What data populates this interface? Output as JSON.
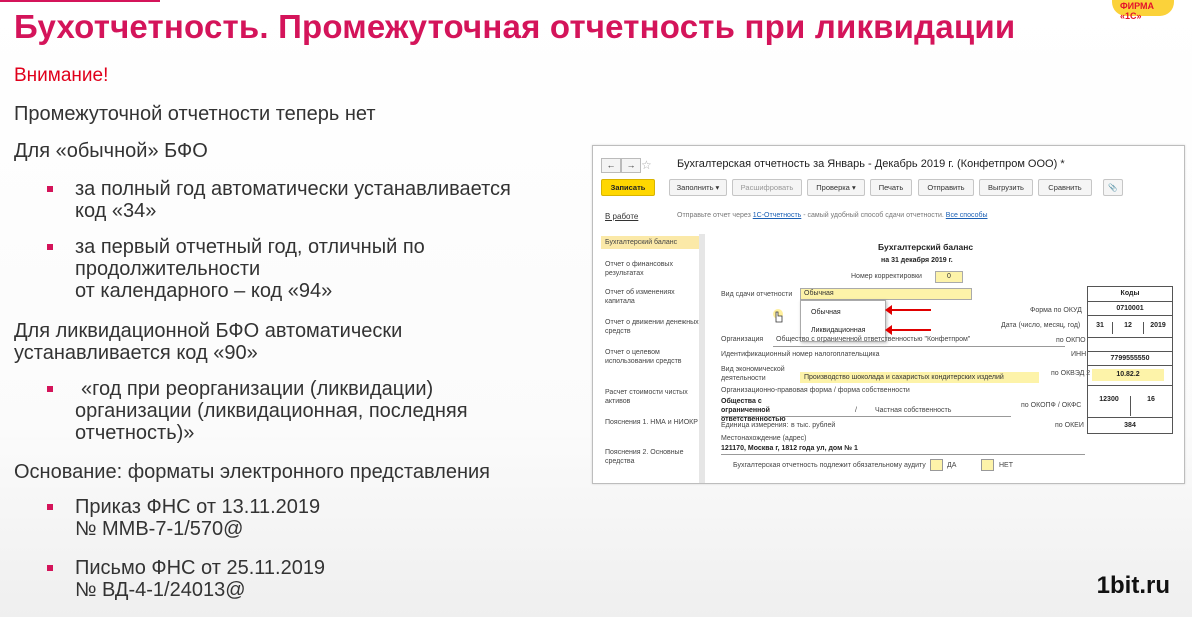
{
  "title": "Бухотчетность. Промежуточная отчетность при ликвидации",
  "logo_text": "ФИРМА «1С»",
  "brand": "1bit.ru",
  "content": {
    "attention": "Внимание!",
    "line1": "Промежуточной отчетности теперь нет",
    "usual_heading": "Для «обычной» БФО",
    "usual_bullets": [
      [
        "за полный год автоматически устанавливается",
        "код «34»"
      ],
      [
        "за первый отчетный год, отличный по",
        "продолжительности",
        "от календарного – код «94»"
      ]
    ],
    "liq_heading": [
      "Для ликвидационной БФО автоматически",
      "устанавливается код «90»"
    ],
    "liq_bullet": [
      "«год при реорганизации (ликвидации)",
      "организации (ликвидационная, последняя",
      "отчетность)»"
    ],
    "basis_heading": "Основание: форматы электронного представления",
    "basis_bullets": [
      [
        "Приказ ФНС от 13.11.2019",
        "№ ММВ-7-1/570@"
      ],
      [
        "Письмо ФНС от 25.11.2019",
        "№ ВД-4-1/24013@"
      ]
    ]
  },
  "window": {
    "title": "Бухгалтерская отчетность за Январь - Декабрь 2019 г. (Конфетпром ООО) *",
    "nav_back": "←",
    "nav_fwd": "→",
    "toolbar": {
      "save": "Записать",
      "fill": "Заполнить ▾",
      "decode": "Расшифровать",
      "check": "Проверка ▾",
      "print": "Печать",
      "send": "Отправить",
      "upload": "Выгрузить",
      "compare": "Сравнить",
      "attach": "📎"
    },
    "status": "В работе",
    "send_prefix": "Отправьте отчет через ",
    "send_link": "1С-Отчетность",
    "send_middle": " - самый удобный способ сдачи отчетности. ",
    "send_link2": "Все способы",
    "sidebar": [
      "Бухгалтерский баланс",
      "Отчет о финансовых результатах",
      "Отчет об изменениях капитала",
      "Отчет о движении денежных средств",
      "Отчет о целевом использовании средств",
      "Расчет стоимости чистых активов",
      "Пояснения 1. НМА и НИОКР",
      "Пояснения 2. Основные средства"
    ],
    "form": {
      "heading": "Бухгалтерский баланс",
      "date": "на 31 декабря 2019 г.",
      "corr_label": "Номер корректировки",
      "corr_value": "0",
      "submission_label": "Вид сдачи отчетности",
      "submission_value": "Обычная",
      "options": [
        "Обычная",
        "Ликвидационная"
      ],
      "codes_header": "Коды",
      "okud_label": "Форма по ОКУД",
      "okud": "0710001",
      "date_label": "Дата (число, месяц, год)",
      "day": "31",
      "month": "12",
      "year": "2019",
      "org_label": "Организация",
      "org_value": "Общество с ограниченной ответственностью \"Конфетпром\"",
      "okpo_label": "по ОКПО",
      "inn_text": "Идентификационный номер налогоплательщика",
      "inn_label": "ИНН",
      "inn": "7799555550",
      "activity_label": "Вид экономической деятельности",
      "activity_value": "Производство шоколада и сахаристых кондитерских изделий",
      "okved_label": "по ОКВЭД 2",
      "okved": "10.82.2",
      "opf_label": "Организационно-правовая форма / форма собственности",
      "opf_value": "Общества с ограниченной ответственностью",
      "own_value": "Частная собственность",
      "okopf_label": "по ОКОПФ / ОКФС",
      "okopf": "12300",
      "okfs": "16",
      "unit_label": "Единица измерения:",
      "unit_value": "в тыс. рублей",
      "okei_label": "по ОКЕИ",
      "okei": "384",
      "address_label": "Местонахождение (адрес)",
      "address_value": "121170, Москва г, 1812 года ул, дом № 1",
      "audit_label": "Бухгалтерская отчетность подлежит обязательному аудиту",
      "yes": "ДА",
      "no": "НЕТ"
    }
  }
}
